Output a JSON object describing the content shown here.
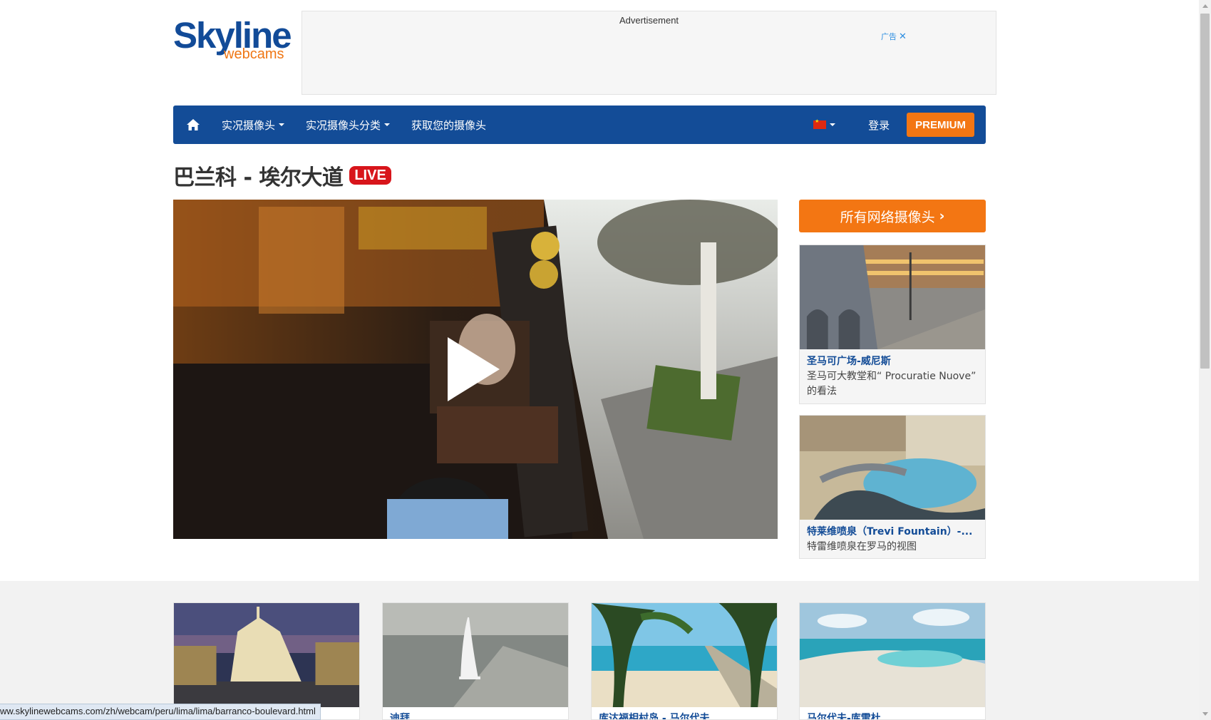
{
  "logo": {
    "line1": "Skyline",
    "line2": "webcams"
  },
  "ad": {
    "label": "Advertisement",
    "choice_label": "广告",
    "close_glyph": "✕"
  },
  "nav": {
    "items": [
      {
        "label": "实况摄像头",
        "dropdown": true
      },
      {
        "label": "实况摄像头分类",
        "dropdown": true
      },
      {
        "label": "获取您的摄像头",
        "dropdown": false
      }
    ],
    "language_icon": "china-flag-icon",
    "login_label": "登录",
    "premium_label": "PREMIUM"
  },
  "page": {
    "title": "巴兰科 - 埃尔大道",
    "live_badge": "LIVE"
  },
  "sidebar": {
    "cta_label": "所有网络摄像头",
    "cta_chevron": "›",
    "cards": [
      {
        "name": "圣马可广场-威尼斯",
        "desc": "圣马可大教堂和“ Procuratie Nuove” 的看法"
      },
      {
        "name": "特莱维喷泉（Trevi Fountain）-...",
        "desc": "特雷维喷泉在罗马的视图"
      }
    ]
  },
  "grid": {
    "cards": [
      {
        "name": ""
      },
      {
        "name": "迪拜"
      },
      {
        "name": "库达福相村岛 - 马尔代夫"
      },
      {
        "name": "马尔代夫-库雷杜"
      }
    ]
  },
  "status_bar": {
    "url": "ww.skylinewebcams.com/zh/webcam/peru/lima/lima/barranco-boulevard.html"
  },
  "colors": {
    "brand_blue": "#134c97",
    "accent_orange": "#f37613",
    "live_red": "#d8151b"
  }
}
